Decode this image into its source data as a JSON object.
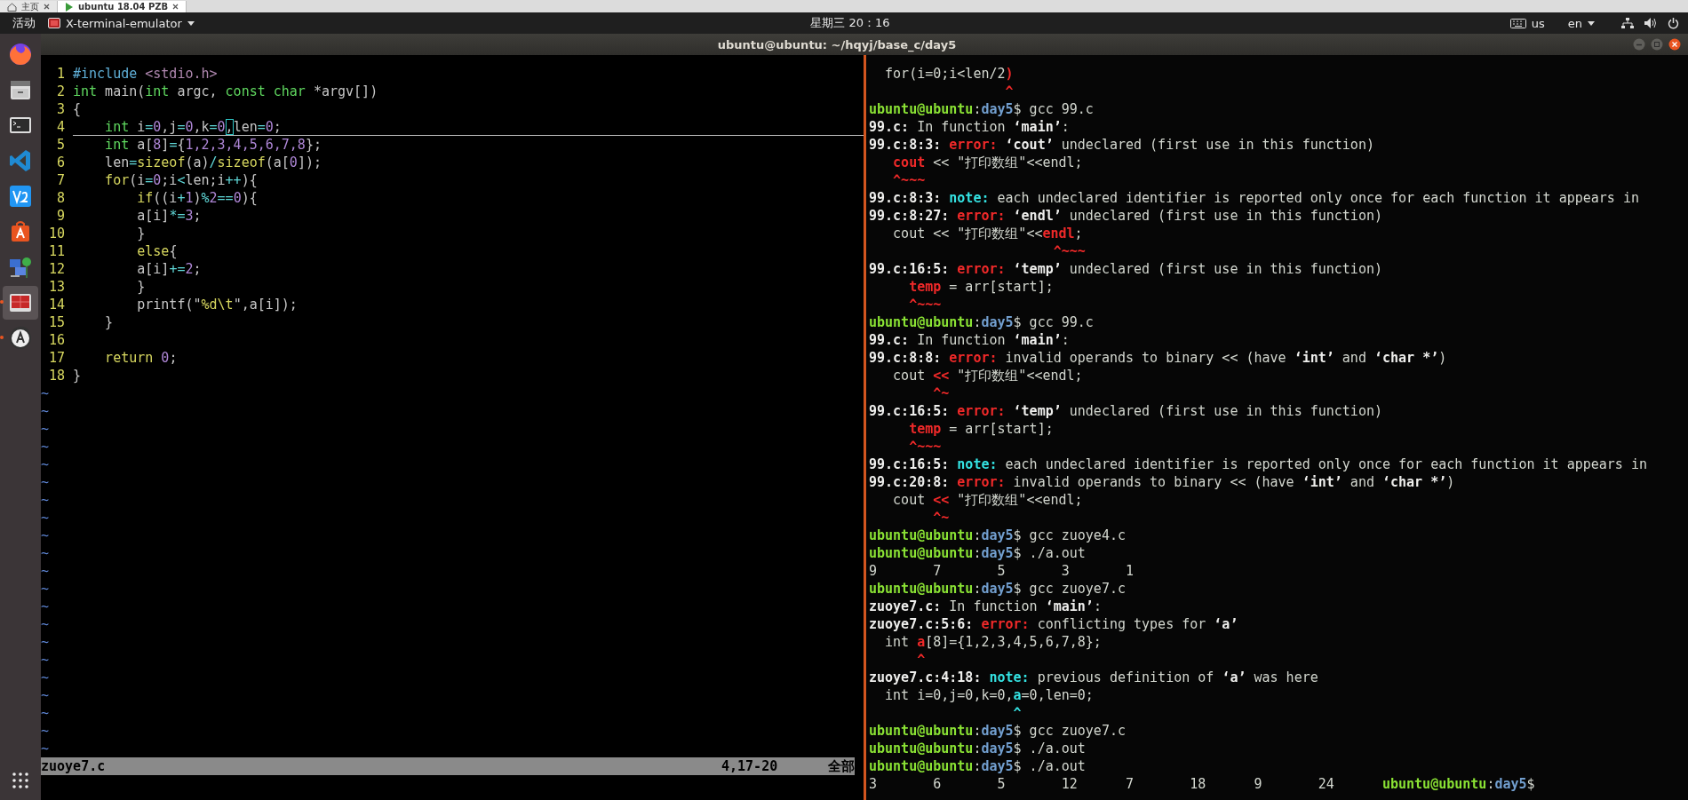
{
  "browser_tabs": [
    {
      "label": "主页",
      "kind": "home",
      "selected": false
    },
    {
      "label": "ubuntu 18.04 PZB",
      "kind": "vm",
      "selected": true
    }
  ],
  "top_panel": {
    "activities": "活动",
    "app_menu": "X-terminal-emulator",
    "clock": "星期三 20：16",
    "keyboard": "us",
    "language": "en"
  },
  "launcher": {
    "items": [
      {
        "kind": "browser",
        "running": false,
        "selected": false
      },
      {
        "kind": "files",
        "running": false,
        "selected": false
      },
      {
        "kind": "terminal",
        "running": false,
        "selected": false
      },
      {
        "kind": "code-editor",
        "running": false,
        "selected": false
      },
      {
        "kind": "app-tile",
        "running": false,
        "selected": false
      },
      {
        "kind": "software",
        "running": false,
        "selected": false
      },
      {
        "kind": "network",
        "running": false,
        "selected": false
      },
      {
        "kind": "slides",
        "running": true,
        "selected": true
      },
      {
        "kind": "updater",
        "running": true,
        "selected": false
      }
    ]
  },
  "window": {
    "title": "ubuntu@ubuntu: ~/hqyj/base_c/day5"
  },
  "editor": {
    "lines": [
      {
        "number": "1",
        "current": false,
        "segments": [
          {
            "kind": "preproc",
            "text": "#include "
          },
          {
            "kind": "include",
            "text": "<stdio.h>"
          }
        ]
      },
      {
        "number": "2",
        "current": false,
        "segments": [
          {
            "kind": "type",
            "text": "int"
          },
          {
            "kind": "plain",
            "text": " main("
          },
          {
            "kind": "type",
            "text": "int"
          },
          {
            "kind": "plain",
            "text": " argc, "
          },
          {
            "kind": "type",
            "text": "const char"
          },
          {
            "kind": "plain",
            "text": " *argv[])"
          }
        ]
      },
      {
        "number": "3",
        "current": false,
        "segments": [
          {
            "kind": "plain",
            "text": "{"
          }
        ]
      },
      {
        "number": "4",
        "current": true,
        "segments": [
          {
            "kind": "type",
            "text": "    int"
          },
          {
            "kind": "plain",
            "text": " i"
          },
          {
            "kind": "operator",
            "text": "="
          },
          {
            "kind": "number",
            "text": "0"
          },
          {
            "kind": "plain",
            "text": ",j"
          },
          {
            "kind": "operator",
            "text": "="
          },
          {
            "kind": "number",
            "text": "0"
          },
          {
            "kind": "plain",
            "text": ",k"
          },
          {
            "kind": "operator",
            "text": "="
          },
          {
            "kind": "number",
            "text": "0"
          },
          {
            "kind": "cursor",
            "text": ","
          },
          {
            "kind": "plain",
            "text": "len"
          },
          {
            "kind": "operator",
            "text": "="
          },
          {
            "kind": "number",
            "text": "0"
          },
          {
            "kind": "plain",
            "text": ";"
          }
        ]
      },
      {
        "number": "5",
        "current": false,
        "segments": [
          {
            "kind": "type",
            "text": "    int"
          },
          {
            "kind": "plain",
            "text": " a["
          },
          {
            "kind": "number",
            "text": "8"
          },
          {
            "kind": "plain",
            "text": "]"
          },
          {
            "kind": "operator",
            "text": "="
          },
          {
            "kind": "plain",
            "text": "{"
          },
          {
            "kind": "number",
            "text": "1,2,3,4,5,6,7,8"
          },
          {
            "kind": "plain",
            "text": "};"
          }
        ]
      },
      {
        "number": "6",
        "current": false,
        "segments": [
          {
            "kind": "plain",
            "text": "    len"
          },
          {
            "kind": "operator",
            "text": "="
          },
          {
            "kind": "keyword",
            "text": "sizeof"
          },
          {
            "kind": "plain",
            "text": "(a)"
          },
          {
            "kind": "operator",
            "text": "/"
          },
          {
            "kind": "keyword",
            "text": "sizeof"
          },
          {
            "kind": "plain",
            "text": "(a["
          },
          {
            "kind": "number",
            "text": "0"
          },
          {
            "kind": "plain",
            "text": "]);"
          }
        ]
      },
      {
        "number": "7",
        "current": false,
        "segments": [
          {
            "kind": "keyword",
            "text": "    for"
          },
          {
            "kind": "plain",
            "text": "(i"
          },
          {
            "kind": "operator",
            "text": "="
          },
          {
            "kind": "number",
            "text": "0"
          },
          {
            "kind": "plain",
            "text": ";i"
          },
          {
            "kind": "operator",
            "text": "<"
          },
          {
            "kind": "plain",
            "text": "len;i"
          },
          {
            "kind": "operator",
            "text": "++"
          },
          {
            "kind": "plain",
            "text": "){"
          }
        ]
      },
      {
        "number": "8",
        "current": false,
        "segments": [
          {
            "kind": "keyword",
            "text": "        if"
          },
          {
            "kind": "plain",
            "text": "((i"
          },
          {
            "kind": "operator",
            "text": "+"
          },
          {
            "kind": "number",
            "text": "1"
          },
          {
            "kind": "plain",
            "text": ")"
          },
          {
            "kind": "operator",
            "text": "%"
          },
          {
            "kind": "number",
            "text": "2"
          },
          {
            "kind": "operator",
            "text": "=="
          },
          {
            "kind": "number",
            "text": "0"
          },
          {
            "kind": "plain",
            "text": "){"
          }
        ]
      },
      {
        "number": "9",
        "current": false,
        "segments": [
          {
            "kind": "plain",
            "text": "        a[i]"
          },
          {
            "kind": "operator",
            "text": "*="
          },
          {
            "kind": "number",
            "text": "3"
          },
          {
            "kind": "plain",
            "text": ";"
          }
        ]
      },
      {
        "number": "10",
        "current": false,
        "segments": [
          {
            "kind": "plain",
            "text": "        }"
          }
        ]
      },
      {
        "number": "11",
        "current": false,
        "segments": [
          {
            "kind": "keyword",
            "text": "        else"
          },
          {
            "kind": "plain",
            "text": "{"
          }
        ]
      },
      {
        "number": "12",
        "current": false,
        "segments": [
          {
            "kind": "plain",
            "text": "        a[i]"
          },
          {
            "kind": "operator",
            "text": "+="
          },
          {
            "kind": "number",
            "text": "2"
          },
          {
            "kind": "plain",
            "text": ";"
          }
        ]
      },
      {
        "number": "13",
        "current": false,
        "segments": [
          {
            "kind": "plain",
            "text": "        }"
          }
        ]
      },
      {
        "number": "14",
        "current": false,
        "segments": [
          {
            "kind": "plain",
            "text": "        printf(\""
          },
          {
            "kind": "special",
            "text": "%d\\t"
          },
          {
            "kind": "plain",
            "text": "\",a[i]);"
          }
        ]
      },
      {
        "number": "15",
        "current": false,
        "segments": [
          {
            "kind": "plain",
            "text": "    }"
          }
        ]
      },
      {
        "number": "16",
        "current": false
      },
      {
        "number": "17",
        "current": false,
        "segments": [
          {
            "kind": "keyword",
            "text": "    return"
          },
          {
            "kind": "number",
            "text": " 0"
          },
          {
            "kind": "plain",
            "text": ";"
          }
        ]
      },
      {
        "number": "18",
        "current": false,
        "segments": [
          {
            "kind": "plain",
            "text": "}"
          }
        ]
      }
    ],
    "filler": [
      "~",
      "~",
      "~",
      "~",
      "~",
      "~",
      "~",
      "~",
      "~",
      "~",
      "~",
      "~",
      "~",
      "~",
      "~",
      "~",
      "~",
      "~",
      "~",
      "~",
      "~"
    ],
    "status": {
      "file": "zuoye7.c",
      "position": "4,17-20",
      "scroll": "全部"
    }
  },
  "terminal": {
    "lines": [
      [
        {
          "kind": "plain",
          "text": "  for(i=0;i<len/2"
        },
        {
          "kind": "error",
          "text": ")"
        }
      ],
      [
        {
          "kind": "error",
          "text": "                 ^"
        }
      ],
      [
        {
          "kind": "user",
          "text": "ubuntu@ubuntu"
        },
        {
          "kind": "plain",
          "text": ":"
        },
        {
          "kind": "path",
          "text": "day5"
        },
        {
          "kind": "plain",
          "text": "$ gcc 99.c"
        }
      ],
      [
        {
          "kind": "bold",
          "text": "99.c:"
        },
        {
          "kind": "plain",
          "text": " In function "
        },
        {
          "kind": "bold",
          "text": "‘main’"
        },
        {
          "kind": "plain",
          "text": ":"
        }
      ],
      [
        {
          "kind": "bold",
          "text": "99.c:8:3: "
        },
        {
          "kind": "error",
          "text": "error: "
        },
        {
          "kind": "bold",
          "text": "‘cout’"
        },
        {
          "kind": "plain",
          "text": " undeclared (first use in this function)"
        }
      ],
      [
        {
          "kind": "error",
          "text": "   cout"
        },
        {
          "kind": "plain",
          "text": " << \"打印数组\"<<endl;"
        }
      ],
      [
        {
          "kind": "error",
          "text": "   ^~~~"
        }
      ],
      [
        {
          "kind": "bold",
          "text": "99.c:8:3: "
        },
        {
          "kind": "note",
          "text": "note:"
        },
        {
          "kind": "plain",
          "text": " each undeclared identifier is reported only once for each function it appears in"
        }
      ],
      [
        {
          "kind": "bold",
          "text": "99.c:8:27: "
        },
        {
          "kind": "error",
          "text": "error: "
        },
        {
          "kind": "bold",
          "text": "‘endl’"
        },
        {
          "kind": "plain",
          "text": " undeclared (first use in this function)"
        }
      ],
      [
        {
          "kind": "plain",
          "text": "   cout << \"打印数组\"<<"
        },
        {
          "kind": "error",
          "text": "endl"
        },
        {
          "kind": "plain",
          "text": ";"
        }
      ],
      [
        {
          "kind": "error",
          "text": "                       ^~~~"
        }
      ],
      [
        {
          "kind": "bold",
          "text": "99.c:16:5: "
        },
        {
          "kind": "error",
          "text": "error: "
        },
        {
          "kind": "bold",
          "text": "‘temp’"
        },
        {
          "kind": "plain",
          "text": " undeclared (first use in this function)"
        }
      ],
      [
        {
          "kind": "error",
          "text": "     temp"
        },
        {
          "kind": "plain",
          "text": " = arr[start];"
        }
      ],
      [
        {
          "kind": "error",
          "text": "     ^~~~"
        }
      ],
      [
        {
          "kind": "user",
          "text": "ubuntu@ubuntu"
        },
        {
          "kind": "plain",
          "text": ":"
        },
        {
          "kind": "path",
          "text": "day5"
        },
        {
          "kind": "plain",
          "text": "$ gcc 99.c"
        }
      ],
      [
        {
          "kind": "bold",
          "text": "99.c:"
        },
        {
          "kind": "plain",
          "text": " In function "
        },
        {
          "kind": "bold",
          "text": "‘main’"
        },
        {
          "kind": "plain",
          "text": ":"
        }
      ],
      [
        {
          "kind": "bold",
          "text": "99.c:8:8: "
        },
        {
          "kind": "error",
          "text": "error:"
        },
        {
          "kind": "plain",
          "text": " invalid operands to binary << (have "
        },
        {
          "kind": "bold",
          "text": "‘int’"
        },
        {
          "kind": "plain",
          "text": " and "
        },
        {
          "kind": "bold",
          "text": "‘char *’"
        },
        {
          "kind": "plain",
          "text": ")"
        }
      ],
      [
        {
          "kind": "plain",
          "text": "   cout "
        },
        {
          "kind": "error",
          "text": "<<"
        },
        {
          "kind": "plain",
          "text": " \"打印数组\"<<endl;"
        }
      ],
      [
        {
          "kind": "error",
          "text": "        ^~"
        }
      ],
      [
        {
          "kind": "bold",
          "text": "99.c:16:5: "
        },
        {
          "kind": "error",
          "text": "error: "
        },
        {
          "kind": "bold",
          "text": "‘temp’"
        },
        {
          "kind": "plain",
          "text": " undeclared (first use in this function)"
        }
      ],
      [
        {
          "kind": "error",
          "text": "     temp"
        },
        {
          "kind": "plain",
          "text": " = arr[start];"
        }
      ],
      [
        {
          "kind": "error",
          "text": "     ^~~~"
        }
      ],
      [
        {
          "kind": "bold",
          "text": "99.c:16:5: "
        },
        {
          "kind": "note",
          "text": "note:"
        },
        {
          "kind": "plain",
          "text": " each undeclared identifier is reported only once for each function it appears in"
        }
      ],
      [
        {
          "kind": "bold",
          "text": "99.c:20:8: "
        },
        {
          "kind": "error",
          "text": "error:"
        },
        {
          "kind": "plain",
          "text": " invalid operands to binary << (have "
        },
        {
          "kind": "bold",
          "text": "‘int’"
        },
        {
          "kind": "plain",
          "text": " and "
        },
        {
          "kind": "bold",
          "text": "‘char *’"
        },
        {
          "kind": "plain",
          "text": ")"
        }
      ],
      [
        {
          "kind": "plain",
          "text": "   cout "
        },
        {
          "kind": "error",
          "text": "<<"
        },
        {
          "kind": "plain",
          "text": " \"打印数组\"<<endl;"
        }
      ],
      [
        {
          "kind": "error",
          "text": "        ^~"
        }
      ],
      [
        {
          "kind": "user",
          "text": "ubuntu@ubuntu"
        },
        {
          "kind": "plain",
          "text": ":"
        },
        {
          "kind": "path",
          "text": "day5"
        },
        {
          "kind": "plain",
          "text": "$ gcc zuoye4.c"
        }
      ],
      [
        {
          "kind": "user",
          "text": "ubuntu@ubuntu"
        },
        {
          "kind": "plain",
          "text": ":"
        },
        {
          "kind": "path",
          "text": "day5"
        },
        {
          "kind": "plain",
          "text": "$ ./a.out"
        }
      ],
      [
        {
          "kind": "plain",
          "text": "9       7       5       3       1"
        }
      ],
      [
        {
          "kind": "user",
          "text": "ubuntu@ubuntu"
        },
        {
          "kind": "plain",
          "text": ":"
        },
        {
          "kind": "path",
          "text": "day5"
        },
        {
          "kind": "plain",
          "text": "$ gcc zuoye7.c"
        }
      ],
      [
        {
          "kind": "bold",
          "text": "zuoye7.c:"
        },
        {
          "kind": "plain",
          "text": " In function "
        },
        {
          "kind": "bold",
          "text": "‘main’"
        },
        {
          "kind": "plain",
          "text": ":"
        }
      ],
      [
        {
          "kind": "bold",
          "text": "zuoye7.c:5:6: "
        },
        {
          "kind": "error",
          "text": "error:"
        },
        {
          "kind": "plain",
          "text": " conflicting types for "
        },
        {
          "kind": "bold",
          "text": "‘a’"
        }
      ],
      [
        {
          "kind": "plain",
          "text": "  int "
        },
        {
          "kind": "error",
          "text": "a"
        },
        {
          "kind": "plain",
          "text": "[8]={1,2,3,4,5,6,7,8};"
        }
      ],
      [
        {
          "kind": "error",
          "text": "      ^"
        }
      ],
      [
        {
          "kind": "bold",
          "text": "zuoye7.c:4:18: "
        },
        {
          "kind": "note",
          "text": "note:"
        },
        {
          "kind": "plain",
          "text": " previous definition of "
        },
        {
          "kind": "bold",
          "text": "‘a’"
        },
        {
          "kind": "plain",
          "text": " was here"
        }
      ],
      [
        {
          "kind": "plain",
          "text": "  int i=0,j=0,k=0,"
        },
        {
          "kind": "note",
          "text": "a"
        },
        {
          "kind": "plain",
          "text": "=0,len=0;"
        }
      ],
      [
        {
          "kind": "note",
          "text": "                  ^"
        }
      ],
      [
        {
          "kind": "user",
          "text": "ubuntu@ubuntu"
        },
        {
          "kind": "plain",
          "text": ":"
        },
        {
          "kind": "path",
          "text": "day5"
        },
        {
          "kind": "plain",
          "text": "$ gcc zuoye7.c"
        }
      ],
      [
        {
          "kind": "user",
          "text": "ubuntu@ubuntu"
        },
        {
          "kind": "plain",
          "text": ":"
        },
        {
          "kind": "path",
          "text": "day5"
        },
        {
          "kind": "plain",
          "text": "$ ./a.out"
        }
      ],
      [
        {
          "kind": "user",
          "text": "ubuntu@ubuntu"
        },
        {
          "kind": "plain",
          "text": ":"
        },
        {
          "kind": "path",
          "text": "day5"
        },
        {
          "kind": "plain",
          "text": "$ ./a.out"
        }
      ],
      [
        {
          "kind": "plain",
          "text": "3       6       5       12      7       18      9       24      "
        },
        {
          "kind": "user",
          "text": "ubuntu@ubuntu"
        },
        {
          "kind": "plain",
          "text": ":"
        },
        {
          "kind": "path",
          "text": "day5"
        },
        {
          "kind": "plain",
          "text": "$"
        }
      ]
    ]
  }
}
